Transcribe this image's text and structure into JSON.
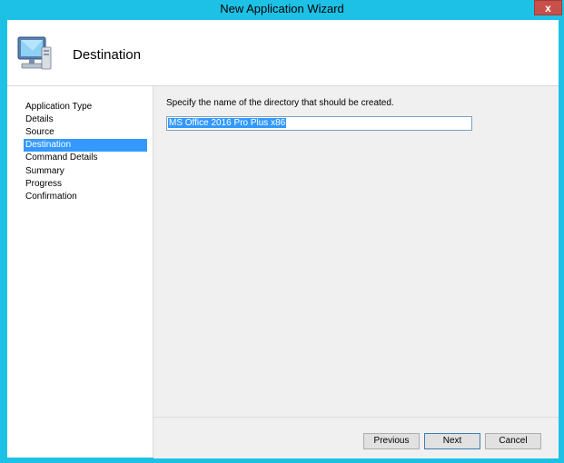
{
  "window": {
    "title": "New Application Wizard",
    "close_label": "x"
  },
  "header": {
    "title": "Destination",
    "icon": "computer-icon"
  },
  "sidebar": {
    "items": [
      {
        "label": "Application Type",
        "active": false
      },
      {
        "label": "Details",
        "active": false
      },
      {
        "label": "Source",
        "active": false
      },
      {
        "label": "Destination",
        "active": true
      },
      {
        "label": "Command Details",
        "active": false
      },
      {
        "label": "Summary",
        "active": false
      },
      {
        "label": "Progress",
        "active": false
      },
      {
        "label": "Confirmation",
        "active": false
      }
    ]
  },
  "main": {
    "prompt": "Specify the name of the directory that should be created.",
    "directory_value": "MS Office 2016 Pro Plus x86"
  },
  "buttons": {
    "previous": "Previous",
    "next": "Next",
    "cancel": "Cancel"
  },
  "colors": {
    "accent": "#1ec1e6",
    "selection": "#3399ff",
    "close": "#c7504a"
  }
}
